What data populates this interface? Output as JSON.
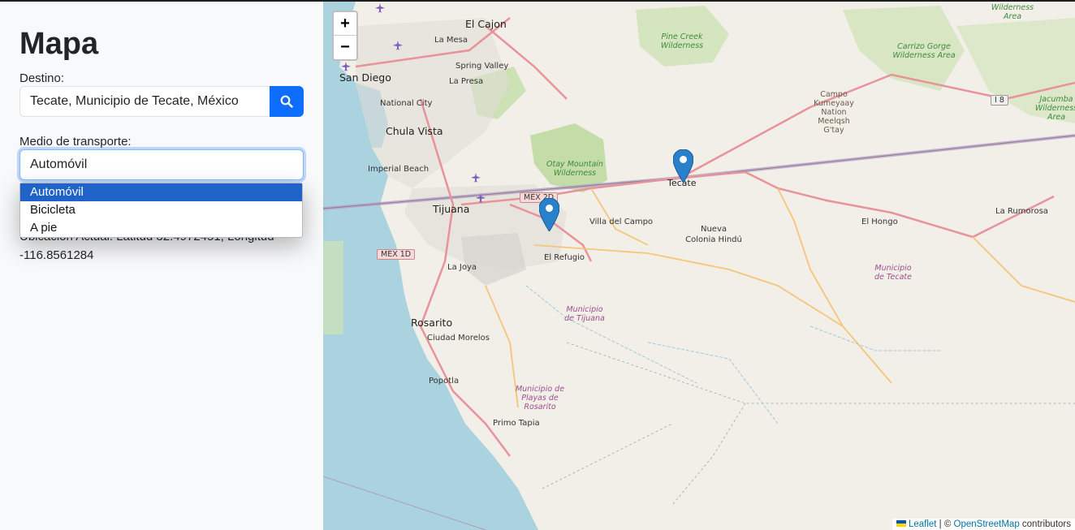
{
  "sidebar": {
    "title": "Mapa",
    "destination_label": "Destino:",
    "destination_value": "Tecate, Municipio de Tecate, México",
    "search_icon": "search-icon",
    "transport_label": "Medio de transporte:",
    "transport_selected": "Automóvil",
    "transport_options": [
      "Automóvil",
      "Bicicleta",
      "A pie"
    ],
    "location_text": "Ubicación Actual: Latitud 32.4972451, Longitud -116.8561284"
  },
  "map": {
    "zoom_in": "+",
    "zoom_out": "−",
    "attribution": {
      "leaflet": "Leaflet",
      "separator": " | © ",
      "osm": "OpenStreetMap",
      "contributors": " contributors"
    },
    "labels": {
      "el_cajon": "El Cajon",
      "la_mesa": "La Mesa",
      "spring_valley": "Spring Valley",
      "la_presa": "La Presa",
      "san_diego": "San Diego",
      "national_city": "National City",
      "chula_vista": "Chula Vista",
      "imperial_beach": "Imperial Beach",
      "tijuana": "Tijuana",
      "la_joya": "La Joya",
      "el_refugio": "El Refugio",
      "villa_del_campo": "Villa del Campo",
      "tecate": "Tecate",
      "nueva_colonia_hindu": "Nueva Colonia Hindú",
      "el_hongo": "El Hongo",
      "la_rumorosa": "La Rumorosa",
      "rosarito": "Rosarito",
      "ciudad_morelos": "Ciudad Morelos",
      "popotla": "Popotla",
      "primo_tapia": "Primo Tapia",
      "pine_creek": "Pine Creek Wilderness",
      "otay_mountain": "Otay Mountain Wilderness",
      "carrizo_gorge": "Carrizo Gorge Wilderness Area",
      "jacumba": "Jacumba Wilderness Area",
      "wilderness_area": "Wilderness Area",
      "campo_kumeyaay": "Campo Kumeyaay Nation Meelqsh G'tay",
      "muni_tecate": "Municipio de Tecate",
      "muni_tijuana": "Municipio de Tijuana",
      "muni_rosarito": "Municipio de Playas de Rosarito"
    },
    "shields": {
      "i8": "I 8",
      "mex2d": "MEX 2D",
      "mex1d": "MEX 1D"
    },
    "markers": [
      "origin-marker",
      "destination-marker-tecate"
    ]
  },
  "colors": {
    "primary": "#0d6efd",
    "marker": "#2a81cb",
    "ocean": "#aad3df",
    "land": "#f2efe9",
    "park": "#c8dfb0",
    "road": "#e8929a"
  }
}
